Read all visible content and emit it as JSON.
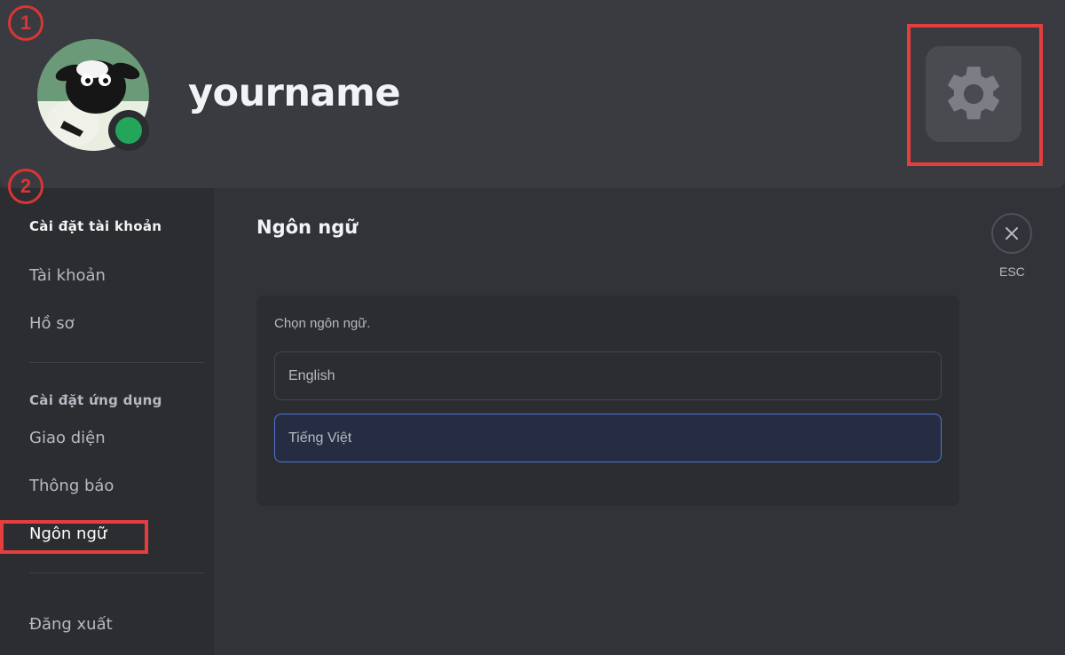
{
  "profile": {
    "username": "yourname",
    "status": "online",
    "avatar_icon": "sheep-avatar-icon"
  },
  "header": {
    "settings_icon": "gear-icon"
  },
  "markers": {
    "step1": "1",
    "step2": "2"
  },
  "sidebar": {
    "account_heading": "Cài đặt tài khoản",
    "account_items": [
      {
        "label": "Tài khoản"
      },
      {
        "label": "Hồ sơ"
      }
    ],
    "app_heading": "Cài đặt ứng dụng",
    "app_items": [
      {
        "label": "Giao diện"
      },
      {
        "label": "Thông báo"
      },
      {
        "label": "Ngôn ngữ",
        "active": true
      }
    ],
    "logout_label": "Đăng xuất"
  },
  "main": {
    "title": "Ngôn ngữ",
    "close_label": "ESC",
    "language_card": {
      "prompt": "Chọn ngôn ngữ.",
      "options": [
        {
          "label": "English",
          "selected": false
        },
        {
          "label": "Tiếng Việt",
          "selected": true
        }
      ]
    }
  },
  "colors": {
    "background": "#313338",
    "sidebar": "#2b2d31",
    "status_online": "#23a55a",
    "selection_border": "#4e76d6",
    "annotation_red": "#e43f3f"
  }
}
